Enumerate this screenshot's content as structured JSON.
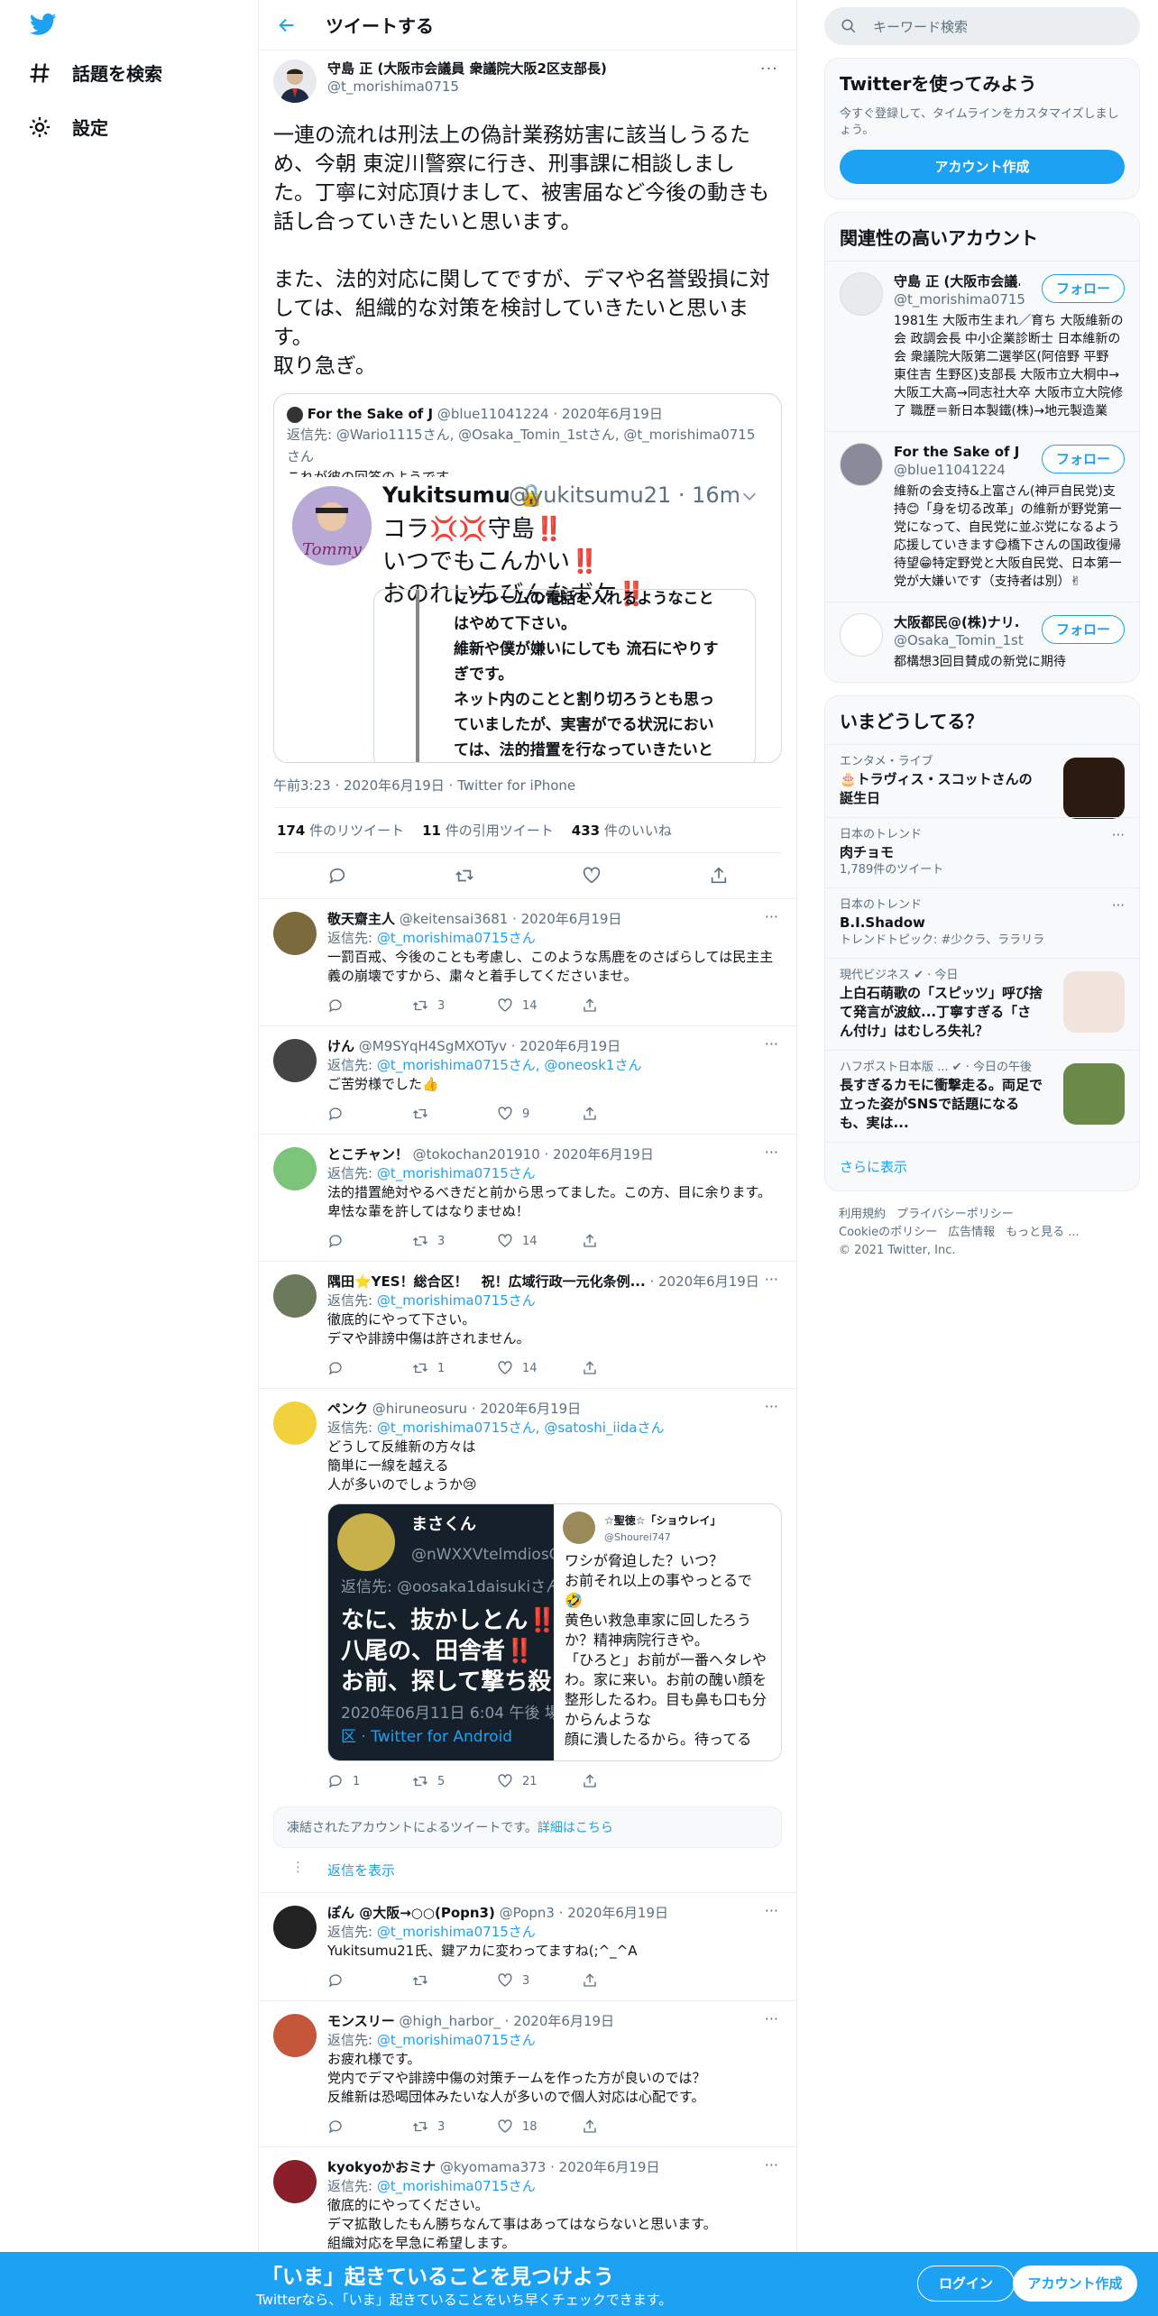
{
  "nav": {
    "explore_label": "話題を検索",
    "settings_label": "設定"
  },
  "header": {
    "title": "ツイートする"
  },
  "tweet": {
    "author_name": "守島 正 (大阪市会議員 衆議院大阪2区支部長)",
    "author_handle": "@t_morishima0715",
    "text": "一連の流れは刑法上の偽計業務妨害に該当しうるた\nめ、今朝 東淀川警察に行き、刑事課に相談しまし\nた。丁寧に対応頂けまして、被害届など今後の動きも\n話し合っていきたいと思います。\n\nまた、法的対応に関してですが、デマや名誉毀損に対\nしては、組織的な対策を検討していきたいと思いま\nす。\n取り急ぎ。",
    "quote": {
      "name": "For the Sake of J",
      "handle": "@blue11041224",
      "date": "2020年6月19日",
      "reply_to_prefix": "返信先: ",
      "reply_to": "@Wario1115さん, @Osaka_Tomin_1stさん, @t_morishima0715さん",
      "text": "これが彼の回答のようです。",
      "image": {
        "name": "Yukitsumu",
        "handle": "@yukitsumu21 · 16m",
        "text": "コラ💢💢守島‼️\nいつでもこんかい‼️\nおのれいちびんなボケ‼️",
        "inner_text": "にクレームの電話を入れるようなこと\nはやめて下さい。\n維新や僕が嫌いにしても 流石にやりす\nぎです。\nネット内のことと割り切ろうとも思っ\nていましたが、実害がでる状況におい\nては、法的措置を行なっていきたいと",
        "avatar_label": "Tommy"
      }
    },
    "meta": "午前3:23 · 2020年6月19日 · Twitter for iPhone",
    "stats": {
      "retweets": "174",
      "retweets_label": "件のリツイート",
      "quotes": "11",
      "quotes_label": "件の引用ツイート",
      "likes": "433",
      "likes_label": "件のいいね"
    }
  },
  "replies": [
    {
      "name": "敬天齋主人",
      "handle": "@keitensai3681 · 2020年6月19日",
      "to": "@t_morishima0715さん",
      "text": "一罰百戒、今後のことも考慮し、このような馬鹿をのさばらしては民主主\n義の崩壊ですから、粛々と着手してくださいませ。",
      "replies": "",
      "retweets": "3",
      "likes": "14",
      "color": "#7a6a3c"
    },
    {
      "name": "けん",
      "handle": "@M9SYqH4SgMXOTyv · 2020年6月19日",
      "to": "@t_morishima0715さん, @oneosk1さん",
      "text": "ご苦労様でした👍",
      "replies": "",
      "retweets": "",
      "likes": "9",
      "color": "#444444"
    },
    {
      "name": "とこチャン！",
      "handle": "@tokochan201910 · 2020年6月19日",
      "to": "@t_morishima0715さん",
      "text": "法的措置絶対やるべきだと前から思ってました。この方、目に余ります。\n卑怯な輩を許してはなりませぬ！",
      "replies": "",
      "retweets": "3",
      "likes": "14",
      "color": "#7cc47a"
    },
    {
      "name": "隅田⭐YES！総合区！　祝！広域行政一元化条例...",
      "handle": " · 2020年6月19日",
      "to": "@t_morishima0715さん",
      "text": "徹底的にやって下さい。\nデマや誹謗中傷は許されません。",
      "replies": "",
      "retweets": "1",
      "likes": "14",
      "color": "#6b7a5a"
    },
    {
      "name": "ペンク",
      "handle": "@hiruneosuru · 2020年6月19日",
      "to": "@t_morishima0715さん, @satoshi_iidaさん",
      "text": "どうして反維新の方々は\n簡単に一線を越える\n人が多いのでしょうか😢",
      "replies": "1",
      "retweets": "5",
      "likes": "21",
      "color": "#f2d23c"
    },
    {
      "name": "ぽん @大阪→○○(Popn3)",
      "handle": "@Popn3 · 2020年6月19日",
      "to": "@t_morishima0715さん",
      "text": "Yukitsumu21氏、鍵アカに変わってますね(;^_^A",
      "replies": "",
      "retweets": "",
      "likes": "3",
      "color": "#222222"
    },
    {
      "name": "モンスリー",
      "handle": "@high_harbor_ · 2020年6月19日",
      "to": "@t_morishima0715さん",
      "text": "お疲れ様です。\n党内でデマや誹謗中傷の対策チームを作った方が良いのでは？\n反維新は恐喝団体みたいな人が多いので個人対応は心配です。",
      "replies": "",
      "retweets": "3",
      "likes": "18",
      "color": "#c4573a"
    },
    {
      "name": "kyokyoかおミナ",
      "handle": "@kyomama373 · 2020年6月19日",
      "to": "@t_morishima0715さん",
      "text": "徹底的にやってください。\nデマ拡散したもん勝ちなんて事はあってはならないと思います。\n組織対応を早急に希望します。",
      "replies": "",
      "retweets": "",
      "likes": "",
      "color": "#8a1f2a"
    }
  ],
  "reply_to_prefix": "返信先: ",
  "media": {
    "left_name": "まさくん",
    "left_handle": "@nWXXVtelmdiosO",
    "left_reply": "返信先: @oosaka1daisukiさん",
    "left_text": "なに、抜かしとん‼️\n八尾の、田舎者‼️\nお前、探して撃ち殺",
    "left_date": "2020年06月11日 6:04 午後 場",
    "left_client": "区 · Twitter for Android",
    "right_name": "☆聖徳☆「ショウレイ」",
    "right_handle": "@Shourei747",
    "right_text": "ワシが脅迫した？いつ？\nお前それ以上の事やっとるで\n🤣\n黄色い救急車家に回したろう\nか？精神病院行きや。\n「ひろと」お前が一番ヘタレや\nわ。家に来い。お前の醜い顔を\n整形したるわ。目も鼻も口も分\nからんような\n顔に潰したるから。待ってる"
  },
  "frozen": {
    "text": "凍結されたアカウントによるツイートです。",
    "link": "詳細はこちら"
  },
  "show_replies": "返信を表示",
  "right": {
    "search_placeholder": "キーワード検索",
    "join_title": "Twitterを使ってみよう",
    "join_sub": "今すぐ登録して、タイムラインをカスタマイズしましょう。",
    "join_button": "アカウント作成",
    "relevant_title": "関連性の高いアカウント",
    "follow_label": "フォロー",
    "accounts": [
      {
        "name": "守島 正 (大阪市会議...",
        "handle": "@t_morishima0715",
        "bio": "1981生 大阪市生まれ／育ち 大阪維新の会 政調会長 中小企業診断士 日本維新の会 衆議院大阪第二選挙区(阿倍野 平野 東住吉 生野区)支部長 大阪市立大桐中→大阪工大高→同志社大卒 大阪市立大院修了 職歴＝新日本製鐵(株)→地元製造業"
      },
      {
        "name": "For the Sake of J",
        "handle": "@blue11041224",
        "bio": "維新の会支持&上富さん(神戸自民党)支持😊「身を切る改革」の維新が野党第一党になって、自民党に並ぶ党になるよう応援していきます😋橋下さんの国政復帰待望😁特定野党と大阪自民党、日本第一党が大嫌いです（支持者は別）✌"
      },
      {
        "name": "大阪都民@(株)ナリ...",
        "handle": "@Osaka_Tomin_1st",
        "bio": "都構想3回目賛成の新党に期待"
      }
    ],
    "trends_title": "いまどうしてる？",
    "trends": [
      {
        "ctx": "エンタメ・ライブ",
        "title": "🎂トラヴィス・スコットさんの誕生日",
        "sub": "",
        "img": true
      },
      {
        "ctx": "日本のトレンド",
        "title": "肉チョモ",
        "sub": "1,789件のツイート",
        "img": false
      },
      {
        "ctx": "日本のトレンド",
        "title": "B.I.Shadow",
        "sub": "トレンドトピック: #少クラ、ララリラ",
        "img": false
      },
      {
        "ctx": "現代ビジネス ✔ · 今日",
        "title": "上白石萌歌の「スピッツ」呼び捨て発言が波紋...丁寧すぎる「さん付け」はむしろ失礼？",
        "sub": "",
        "img": true
      },
      {
        "ctx": "ハフポスト日本版 ... ✔ · 今日の午後",
        "title": "長すぎるカモに衝撃走る。両足で立った姿がSNSで話題になるも、実は...",
        "sub": "",
        "img": true
      }
    ],
    "show_more": "さらに表示",
    "footer": [
      "利用規約",
      "プライバシーポリシー",
      "Cookieのポリシー",
      "広告情報",
      "もっと見る ...",
      "© 2021 Twitter, Inc."
    ]
  },
  "bottom": {
    "title": "「いま」起きていることを見つけよう",
    "sub": "Twitterなら、「いま」起きていることをいち早くチェックできます。",
    "login": "ログイン",
    "signup": "アカウント作成"
  }
}
